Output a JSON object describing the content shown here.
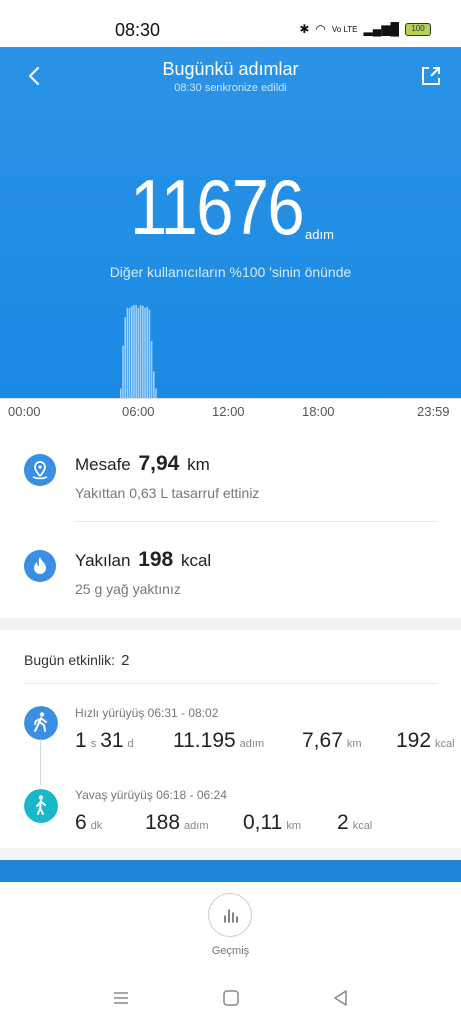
{
  "status": {
    "time": "08:30",
    "battery": "100",
    "network": "Vo LTE"
  },
  "header": {
    "title": "Bugünkü adımlar",
    "subtitle": "08:30 senkronize edildi"
  },
  "summary": {
    "steps": "11676",
    "steps_unit": "adım",
    "rank_text": "Diğer kullanıcıların %100 'sinin önünde"
  },
  "chart_data": {
    "type": "bar",
    "title": "",
    "x_ticks": [
      "00:00",
      "06:00",
      "12:00",
      "18:00",
      "23:59"
    ],
    "series": [
      {
        "values": [
          0.1,
          0.55,
          0.85,
          0.95,
          0.95,
          0.97,
          0.98,
          0.98,
          0.95,
          0.98,
          0.97,
          0.95,
          0.96,
          0.93,
          0.6,
          0.28,
          0.1
        ]
      }
    ],
    "color": "#9fd0f7"
  },
  "distance": {
    "label": "Mesafe",
    "value": "7,94",
    "unit": "km",
    "note": "Yakıttan 0,63 L tasarruf ettiniz"
  },
  "calories": {
    "label": "Yakılan",
    "value": "198",
    "unit": "kcal",
    "note": "25 g yağ yaktınız"
  },
  "activities": {
    "header": "Bugün etkinlik:",
    "count": "2",
    "items": [
      {
        "label": "Hızlı yürüyüş 06:31 - 08:02",
        "dur1": "1",
        "dur1_unit": "s",
        "dur2": "31",
        "dur2_unit": "d",
        "steps": "11.195",
        "steps_unit": "adım",
        "dist": "7,67",
        "dist_unit": "km",
        "kcal": "192",
        "kcal_unit": "kcal",
        "color": "#3a8fe3"
      },
      {
        "label": "Yavaş yürüyüş 06:18 - 06:24",
        "dur1": "6",
        "dur1_unit": "dk",
        "steps": "188",
        "steps_unit": "adım",
        "dist": "0,11",
        "dist_unit": "km",
        "kcal": "2",
        "kcal_unit": "kcal",
        "color": "#18b7c9"
      }
    ]
  },
  "bottom": {
    "history_label": "Geçmiş"
  },
  "colors": {
    "accent": "#1b8ae3",
    "hero": "#2a93e6"
  }
}
